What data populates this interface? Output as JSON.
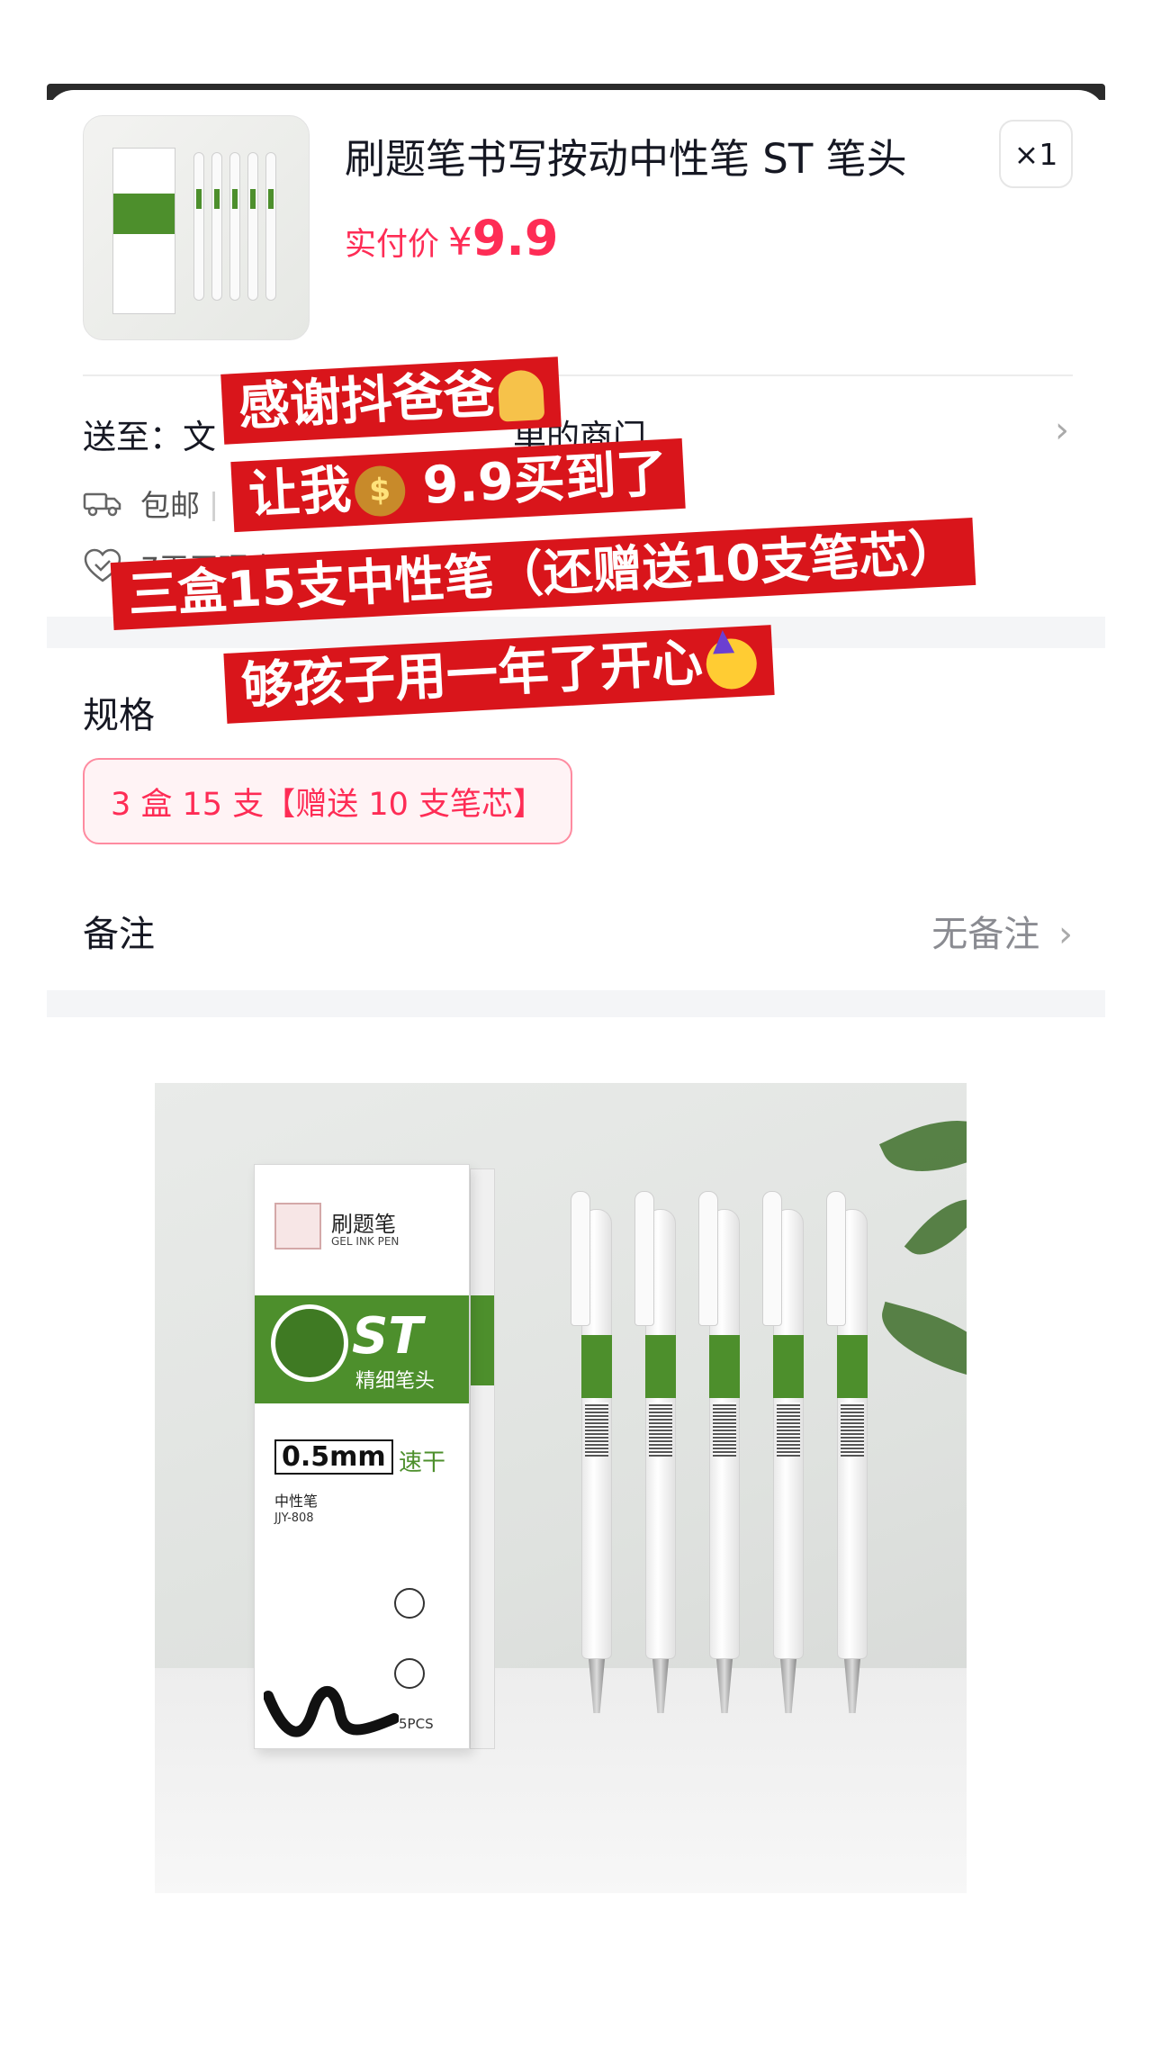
{
  "order": {
    "title": "刷题笔书写按动中性笔 ST 笔头",
    "quantity": "×1",
    "price_label": "实付价",
    "currency": "¥",
    "price": "9.9",
    "ship_to_label": "送至：文",
    "ship_to_tail": "单的商门",
    "service_free_shipping": "包邮",
    "return_policy": "7天无理由退货",
    "spec_label": "规格",
    "spec_value": "3 盒 15 支【赠送 10 支笔芯】",
    "note_label": "备注",
    "note_value": "无备注",
    "chevron": "›"
  },
  "overlay": {
    "line1": "感谢抖爸爸",
    "line2_prefix": "让我",
    "line2_suffix": " 9.9买到了",
    "line3": "三盒15支中性笔（还赠送10支笔芯）",
    "line4": "够孩子用一年了开心",
    "emoji_names": [
      "praying-hands",
      "money-bag",
      "party-face"
    ]
  },
  "product_image": {
    "brand": "刷题笔",
    "brand_en": "GEL INK PEN",
    "st": "ST",
    "st_sub": "精细笔头",
    "size": "0.5mm",
    "fast": "速干",
    "type": "中性笔",
    "model": "JJY-808",
    "pcs": "5PCS"
  },
  "colors": {
    "accent_red": "#fe2c55",
    "banner_red": "#d9151b",
    "pen_green": "#4d8f2c"
  }
}
